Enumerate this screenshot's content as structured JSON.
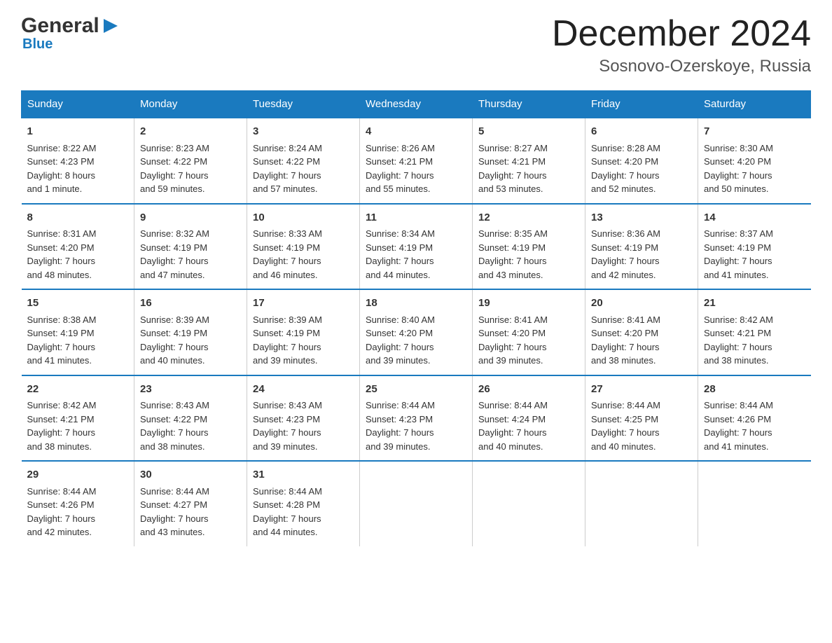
{
  "logo": {
    "general": "General",
    "arrow": "▶",
    "blue": "Blue"
  },
  "title": "December 2024",
  "subtitle": "Sosnovo-Ozerskoye, Russia",
  "days_header": [
    "Sunday",
    "Monday",
    "Tuesday",
    "Wednesday",
    "Thursday",
    "Friday",
    "Saturday"
  ],
  "weeks": [
    [
      {
        "day": "1",
        "info": "Sunrise: 8:22 AM\nSunset: 4:23 PM\nDaylight: 8 hours\nand 1 minute."
      },
      {
        "day": "2",
        "info": "Sunrise: 8:23 AM\nSunset: 4:22 PM\nDaylight: 7 hours\nand 59 minutes."
      },
      {
        "day": "3",
        "info": "Sunrise: 8:24 AM\nSunset: 4:22 PM\nDaylight: 7 hours\nand 57 minutes."
      },
      {
        "day": "4",
        "info": "Sunrise: 8:26 AM\nSunset: 4:21 PM\nDaylight: 7 hours\nand 55 minutes."
      },
      {
        "day": "5",
        "info": "Sunrise: 8:27 AM\nSunset: 4:21 PM\nDaylight: 7 hours\nand 53 minutes."
      },
      {
        "day": "6",
        "info": "Sunrise: 8:28 AM\nSunset: 4:20 PM\nDaylight: 7 hours\nand 52 minutes."
      },
      {
        "day": "7",
        "info": "Sunrise: 8:30 AM\nSunset: 4:20 PM\nDaylight: 7 hours\nand 50 minutes."
      }
    ],
    [
      {
        "day": "8",
        "info": "Sunrise: 8:31 AM\nSunset: 4:20 PM\nDaylight: 7 hours\nand 48 minutes."
      },
      {
        "day": "9",
        "info": "Sunrise: 8:32 AM\nSunset: 4:19 PM\nDaylight: 7 hours\nand 47 minutes."
      },
      {
        "day": "10",
        "info": "Sunrise: 8:33 AM\nSunset: 4:19 PM\nDaylight: 7 hours\nand 46 minutes."
      },
      {
        "day": "11",
        "info": "Sunrise: 8:34 AM\nSunset: 4:19 PM\nDaylight: 7 hours\nand 44 minutes."
      },
      {
        "day": "12",
        "info": "Sunrise: 8:35 AM\nSunset: 4:19 PM\nDaylight: 7 hours\nand 43 minutes."
      },
      {
        "day": "13",
        "info": "Sunrise: 8:36 AM\nSunset: 4:19 PM\nDaylight: 7 hours\nand 42 minutes."
      },
      {
        "day": "14",
        "info": "Sunrise: 8:37 AM\nSunset: 4:19 PM\nDaylight: 7 hours\nand 41 minutes."
      }
    ],
    [
      {
        "day": "15",
        "info": "Sunrise: 8:38 AM\nSunset: 4:19 PM\nDaylight: 7 hours\nand 41 minutes."
      },
      {
        "day": "16",
        "info": "Sunrise: 8:39 AM\nSunset: 4:19 PM\nDaylight: 7 hours\nand 40 minutes."
      },
      {
        "day": "17",
        "info": "Sunrise: 8:39 AM\nSunset: 4:19 PM\nDaylight: 7 hours\nand 39 minutes."
      },
      {
        "day": "18",
        "info": "Sunrise: 8:40 AM\nSunset: 4:20 PM\nDaylight: 7 hours\nand 39 minutes."
      },
      {
        "day": "19",
        "info": "Sunrise: 8:41 AM\nSunset: 4:20 PM\nDaylight: 7 hours\nand 39 minutes."
      },
      {
        "day": "20",
        "info": "Sunrise: 8:41 AM\nSunset: 4:20 PM\nDaylight: 7 hours\nand 38 minutes."
      },
      {
        "day": "21",
        "info": "Sunrise: 8:42 AM\nSunset: 4:21 PM\nDaylight: 7 hours\nand 38 minutes."
      }
    ],
    [
      {
        "day": "22",
        "info": "Sunrise: 8:42 AM\nSunset: 4:21 PM\nDaylight: 7 hours\nand 38 minutes."
      },
      {
        "day": "23",
        "info": "Sunrise: 8:43 AM\nSunset: 4:22 PM\nDaylight: 7 hours\nand 38 minutes."
      },
      {
        "day": "24",
        "info": "Sunrise: 8:43 AM\nSunset: 4:23 PM\nDaylight: 7 hours\nand 39 minutes."
      },
      {
        "day": "25",
        "info": "Sunrise: 8:44 AM\nSunset: 4:23 PM\nDaylight: 7 hours\nand 39 minutes."
      },
      {
        "day": "26",
        "info": "Sunrise: 8:44 AM\nSunset: 4:24 PM\nDaylight: 7 hours\nand 40 minutes."
      },
      {
        "day": "27",
        "info": "Sunrise: 8:44 AM\nSunset: 4:25 PM\nDaylight: 7 hours\nand 40 minutes."
      },
      {
        "day": "28",
        "info": "Sunrise: 8:44 AM\nSunset: 4:26 PM\nDaylight: 7 hours\nand 41 minutes."
      }
    ],
    [
      {
        "day": "29",
        "info": "Sunrise: 8:44 AM\nSunset: 4:26 PM\nDaylight: 7 hours\nand 42 minutes."
      },
      {
        "day": "30",
        "info": "Sunrise: 8:44 AM\nSunset: 4:27 PM\nDaylight: 7 hours\nand 43 minutes."
      },
      {
        "day": "31",
        "info": "Sunrise: 8:44 AM\nSunset: 4:28 PM\nDaylight: 7 hours\nand 44 minutes."
      },
      {
        "day": "",
        "info": ""
      },
      {
        "day": "",
        "info": ""
      },
      {
        "day": "",
        "info": ""
      },
      {
        "day": "",
        "info": ""
      }
    ]
  ]
}
